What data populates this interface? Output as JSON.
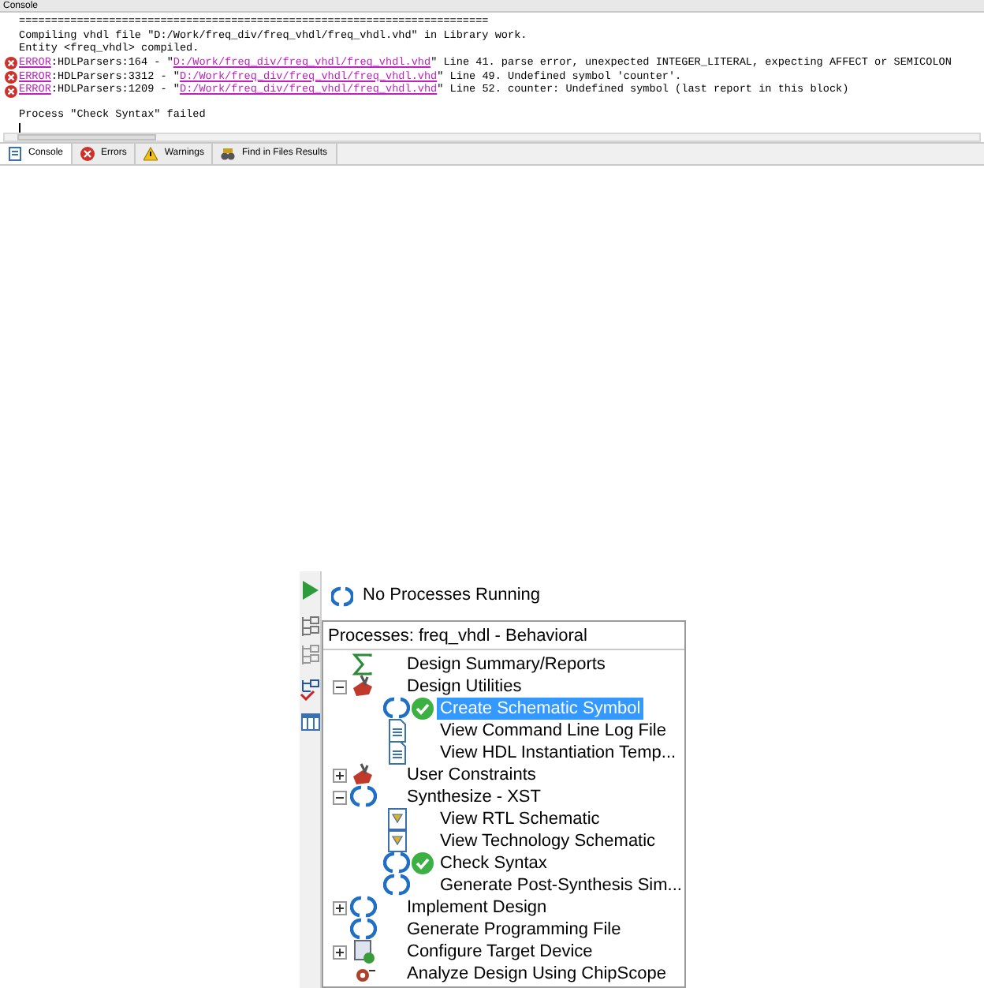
{
  "console": {
    "title": "Console",
    "lines": [
      {
        "kind": "plain",
        "text": "========================================================================="
      },
      {
        "kind": "plain",
        "text": "Compiling vhdl file \"D:/Work/freq_div/freq_vhdl/freq_vhdl.vhd\" in Library work."
      },
      {
        "kind": "plain",
        "text": "Entity <freq_vhdl> compiled."
      },
      {
        "kind": "error",
        "code": "ERROR",
        "source": ":HDLParsers:164 - \"",
        "file": "D:/Work/freq_div/freq_vhdl/freq_vhdl.vhd",
        "message": "\" Line 41. parse error, unexpected INTEGER_LITERAL, expecting AFFECT or SEMICOLON"
      },
      {
        "kind": "error",
        "code": "ERROR",
        "source": ":HDLParsers:3312 - \"",
        "file": "D:/Work/freq_div/freq_vhdl/freq_vhdl.vhd",
        "message": "\" Line 49. Undefined symbol 'counter'."
      },
      {
        "kind": "error",
        "code": "ERROR",
        "source": ":HDLParsers:1209 - \"",
        "file": "D:/Work/freq_div/freq_vhdl/freq_vhdl.vhd",
        "message": "\" Line 52. counter: Undefined symbol (last report in this block)"
      },
      {
        "kind": "blank"
      },
      {
        "kind": "plain",
        "text": "Process \"Check Syntax\" failed"
      }
    ],
    "tabs": [
      {
        "label": "Console",
        "kind": "console",
        "selected": true
      },
      {
        "label": "Errors",
        "kind": "errors",
        "selected": false
      },
      {
        "label": "Warnings",
        "kind": "warnings",
        "selected": false
      },
      {
        "label": "Find in Files Results",
        "kind": "find",
        "selected": false
      }
    ]
  },
  "processes": {
    "status": "No Processes Running",
    "header": "Processes: freq_vhdl - Behavioral",
    "tree": [
      {
        "label": "Design Summary/Reports",
        "kind": "summary",
        "selected": false
      },
      {
        "label": "Design Utilities",
        "kind": "tools",
        "expanded": true,
        "selected": false,
        "children": [
          {
            "label": "Create Schematic Symbol",
            "kind": "process",
            "ok": true,
            "selected": true
          },
          {
            "label": "View Command Line Log File",
            "kind": "report",
            "selected": false
          },
          {
            "label": "View HDL Instantiation Temp...",
            "kind": "report",
            "selected": false
          }
        ]
      },
      {
        "label": "User Constraints",
        "kind": "tools",
        "expanded": false,
        "selected": false
      },
      {
        "label": "Synthesize - XST",
        "kind": "process",
        "expanded": true,
        "selected": false,
        "children": [
          {
            "label": "View RTL Schematic",
            "kind": "schematic",
            "selected": false
          },
          {
            "label": "View Technology Schematic",
            "kind": "schematic",
            "selected": false
          },
          {
            "label": "Check Syntax",
            "kind": "process",
            "ok": true,
            "selected": false
          },
          {
            "label": "Generate Post-Synthesis Sim...",
            "kind": "process",
            "selected": false
          }
        ]
      },
      {
        "label": "Implement Design",
        "kind": "process",
        "expanded": false,
        "selected": false
      },
      {
        "label": "Generate Programming File",
        "kind": "process",
        "selected": false
      },
      {
        "label": "Configure Target Device",
        "kind": "device",
        "expanded": false,
        "selected": false
      },
      {
        "label": "Analyze Design Using ChipScope",
        "kind": "chipscope",
        "selected": false
      }
    ]
  }
}
